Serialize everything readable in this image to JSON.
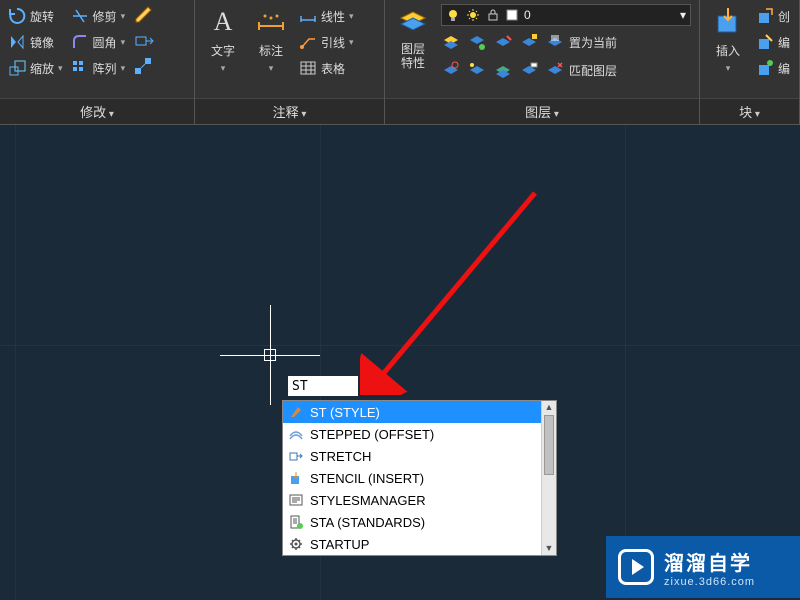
{
  "ribbon": {
    "modify": {
      "title": "修改",
      "rotate": "旋转",
      "mirror": "镜像",
      "scale": "缩放",
      "trim": "修剪",
      "fillet": "圆角",
      "array": "阵列"
    },
    "annotate": {
      "title": "注释",
      "text": "文字",
      "label_tool": "标注",
      "linetype": "线性",
      "leader": "引线",
      "table": "表格"
    },
    "layer": {
      "title": "图层",
      "props": "图层\n特性",
      "current": "0",
      "setcurrent": "置为当前",
      "matchlayer": "匹配图层"
    },
    "block": {
      "title": "块",
      "insert": "插入",
      "create": "创",
      "edit": "编",
      "editattr": "编"
    }
  },
  "cmd": {
    "input": "ST",
    "suggestions": [
      "ST (STYLE)",
      "STEPPED (OFFSET)",
      "STRETCH",
      "STENCIL (INSERT)",
      "STYLESMANAGER",
      "STA (STANDARDS)",
      "STARTUP"
    ]
  },
  "watermark": {
    "main": "溜溜自学",
    "sub": "zixue.3d66.com"
  }
}
